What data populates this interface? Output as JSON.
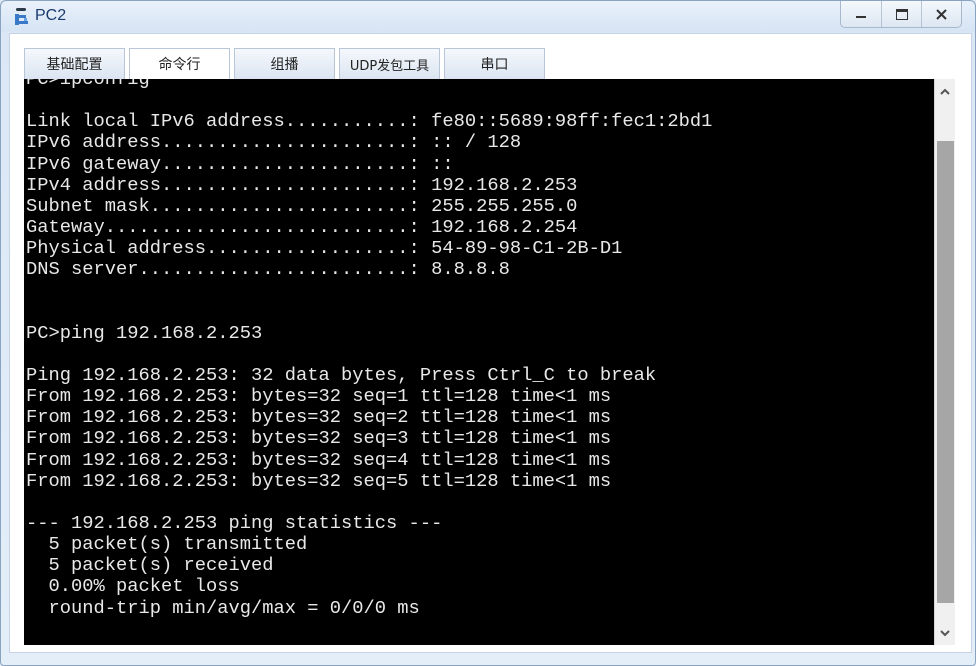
{
  "window": {
    "title": "PC2",
    "icon": "pc-device-icon",
    "controls": {
      "minimize": "_",
      "maximize": "□",
      "close": "X"
    }
  },
  "tabs": [
    {
      "label": "基础配置",
      "active": false
    },
    {
      "label": "命令行",
      "active": true
    },
    {
      "label": "组播",
      "active": false
    },
    {
      "label": "UDP发包工具",
      "active": false
    },
    {
      "label": "串口",
      "active": false
    }
  ],
  "terminal": {
    "lines": [
      "PC>ipconfig",
      "",
      "Link local IPv6 address...........: fe80::5689:98ff:fec1:2bd1",
      "IPv6 address......................: :: / 128",
      "IPv6 gateway......................: ::",
      "IPv4 address......................: 192.168.2.253",
      "Subnet mask.......................: 255.255.255.0",
      "Gateway...........................: 192.168.2.254",
      "Physical address..................: 54-89-98-C1-2B-D1",
      "DNS server........................: 8.8.8.8",
      "",
      "",
      "PC>ping 192.168.2.253",
      "",
      "Ping 192.168.2.253: 32 data bytes, Press Ctrl_C to break",
      "From 192.168.2.253: bytes=32 seq=1 ttl=128 time<1 ms",
      "From 192.168.2.253: bytes=32 seq=2 ttl=128 time<1 ms",
      "From 192.168.2.253: bytes=32 seq=3 ttl=128 time<1 ms",
      "From 192.168.2.253: bytes=32 seq=4 ttl=128 time<1 ms",
      "From 192.168.2.253: bytes=32 seq=5 ttl=128 time<1 ms",
      "",
      "--- 192.168.2.253 ping statistics ---",
      "  5 packet(s) transmitted",
      "  5 packet(s) received",
      "  0.00% packet loss",
      "  round-trip min/avg/max = 0/0/0 ms",
      ""
    ]
  },
  "scrollbar": {
    "up_arrow": "^",
    "down_arrow": "v",
    "position": "bottom"
  }
}
